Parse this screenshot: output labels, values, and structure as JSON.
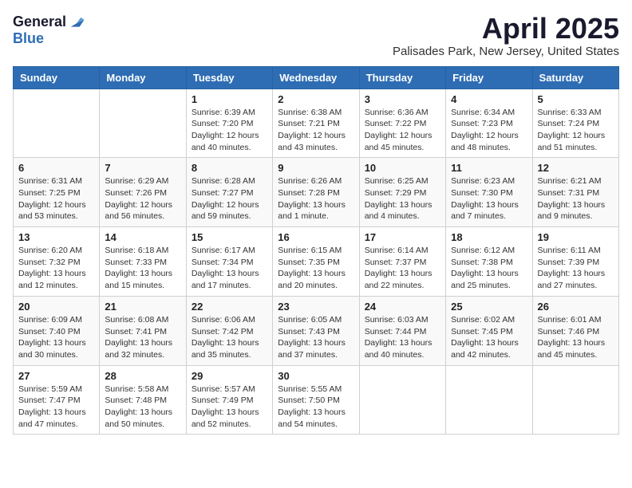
{
  "logo": {
    "general": "General",
    "blue": "Blue"
  },
  "title": "April 2025",
  "location": "Palisades Park, New Jersey, United States",
  "days_of_week": [
    "Sunday",
    "Monday",
    "Tuesday",
    "Wednesday",
    "Thursday",
    "Friday",
    "Saturday"
  ],
  "weeks": [
    [
      {
        "day": "",
        "info": ""
      },
      {
        "day": "",
        "info": ""
      },
      {
        "day": "1",
        "info": "Sunrise: 6:39 AM\nSunset: 7:20 PM\nDaylight: 12 hours and 40 minutes."
      },
      {
        "day": "2",
        "info": "Sunrise: 6:38 AM\nSunset: 7:21 PM\nDaylight: 12 hours and 43 minutes."
      },
      {
        "day": "3",
        "info": "Sunrise: 6:36 AM\nSunset: 7:22 PM\nDaylight: 12 hours and 45 minutes."
      },
      {
        "day": "4",
        "info": "Sunrise: 6:34 AM\nSunset: 7:23 PM\nDaylight: 12 hours and 48 minutes."
      },
      {
        "day": "5",
        "info": "Sunrise: 6:33 AM\nSunset: 7:24 PM\nDaylight: 12 hours and 51 minutes."
      }
    ],
    [
      {
        "day": "6",
        "info": "Sunrise: 6:31 AM\nSunset: 7:25 PM\nDaylight: 12 hours and 53 minutes."
      },
      {
        "day": "7",
        "info": "Sunrise: 6:29 AM\nSunset: 7:26 PM\nDaylight: 12 hours and 56 minutes."
      },
      {
        "day": "8",
        "info": "Sunrise: 6:28 AM\nSunset: 7:27 PM\nDaylight: 12 hours and 59 minutes."
      },
      {
        "day": "9",
        "info": "Sunrise: 6:26 AM\nSunset: 7:28 PM\nDaylight: 13 hours and 1 minute."
      },
      {
        "day": "10",
        "info": "Sunrise: 6:25 AM\nSunset: 7:29 PM\nDaylight: 13 hours and 4 minutes."
      },
      {
        "day": "11",
        "info": "Sunrise: 6:23 AM\nSunset: 7:30 PM\nDaylight: 13 hours and 7 minutes."
      },
      {
        "day": "12",
        "info": "Sunrise: 6:21 AM\nSunset: 7:31 PM\nDaylight: 13 hours and 9 minutes."
      }
    ],
    [
      {
        "day": "13",
        "info": "Sunrise: 6:20 AM\nSunset: 7:32 PM\nDaylight: 13 hours and 12 minutes."
      },
      {
        "day": "14",
        "info": "Sunrise: 6:18 AM\nSunset: 7:33 PM\nDaylight: 13 hours and 15 minutes."
      },
      {
        "day": "15",
        "info": "Sunrise: 6:17 AM\nSunset: 7:34 PM\nDaylight: 13 hours and 17 minutes."
      },
      {
        "day": "16",
        "info": "Sunrise: 6:15 AM\nSunset: 7:35 PM\nDaylight: 13 hours and 20 minutes."
      },
      {
        "day": "17",
        "info": "Sunrise: 6:14 AM\nSunset: 7:37 PM\nDaylight: 13 hours and 22 minutes."
      },
      {
        "day": "18",
        "info": "Sunrise: 6:12 AM\nSunset: 7:38 PM\nDaylight: 13 hours and 25 minutes."
      },
      {
        "day": "19",
        "info": "Sunrise: 6:11 AM\nSunset: 7:39 PM\nDaylight: 13 hours and 27 minutes."
      }
    ],
    [
      {
        "day": "20",
        "info": "Sunrise: 6:09 AM\nSunset: 7:40 PM\nDaylight: 13 hours and 30 minutes."
      },
      {
        "day": "21",
        "info": "Sunrise: 6:08 AM\nSunset: 7:41 PM\nDaylight: 13 hours and 32 minutes."
      },
      {
        "day": "22",
        "info": "Sunrise: 6:06 AM\nSunset: 7:42 PM\nDaylight: 13 hours and 35 minutes."
      },
      {
        "day": "23",
        "info": "Sunrise: 6:05 AM\nSunset: 7:43 PM\nDaylight: 13 hours and 37 minutes."
      },
      {
        "day": "24",
        "info": "Sunrise: 6:03 AM\nSunset: 7:44 PM\nDaylight: 13 hours and 40 minutes."
      },
      {
        "day": "25",
        "info": "Sunrise: 6:02 AM\nSunset: 7:45 PM\nDaylight: 13 hours and 42 minutes."
      },
      {
        "day": "26",
        "info": "Sunrise: 6:01 AM\nSunset: 7:46 PM\nDaylight: 13 hours and 45 minutes."
      }
    ],
    [
      {
        "day": "27",
        "info": "Sunrise: 5:59 AM\nSunset: 7:47 PM\nDaylight: 13 hours and 47 minutes."
      },
      {
        "day": "28",
        "info": "Sunrise: 5:58 AM\nSunset: 7:48 PM\nDaylight: 13 hours and 50 minutes."
      },
      {
        "day": "29",
        "info": "Sunrise: 5:57 AM\nSunset: 7:49 PM\nDaylight: 13 hours and 52 minutes."
      },
      {
        "day": "30",
        "info": "Sunrise: 5:55 AM\nSunset: 7:50 PM\nDaylight: 13 hours and 54 minutes."
      },
      {
        "day": "",
        "info": ""
      },
      {
        "day": "",
        "info": ""
      },
      {
        "day": "",
        "info": ""
      }
    ]
  ]
}
